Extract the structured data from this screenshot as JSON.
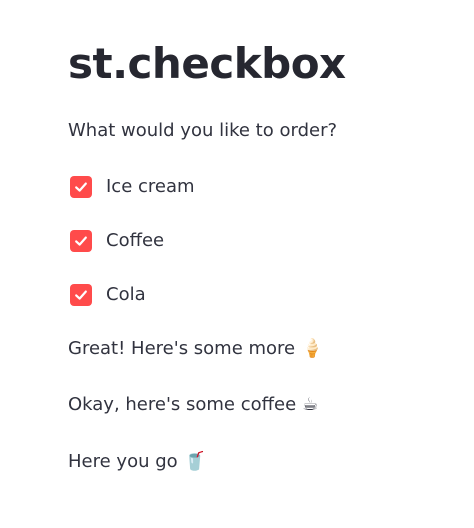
{
  "page": {
    "title": "st.checkbox",
    "prompt": "What would you like to order?"
  },
  "checkboxes": [
    {
      "label": "Ice cream",
      "checked": true
    },
    {
      "label": "Coffee",
      "checked": true
    },
    {
      "label": "Cola",
      "checked": true
    }
  ],
  "messages": [
    {
      "text": "Great! Here's some more",
      "emoji": "🍦"
    },
    {
      "text": "Okay, here's some coffee",
      "emoji": "☕"
    },
    {
      "text": "Here you go",
      "emoji": "🥤"
    }
  ],
  "colors": {
    "accent": "#ff4b4b",
    "text": "#31333f",
    "title": "#262730",
    "background": "#ffffff"
  },
  "icons": {
    "checkbox_check": "check-icon"
  }
}
